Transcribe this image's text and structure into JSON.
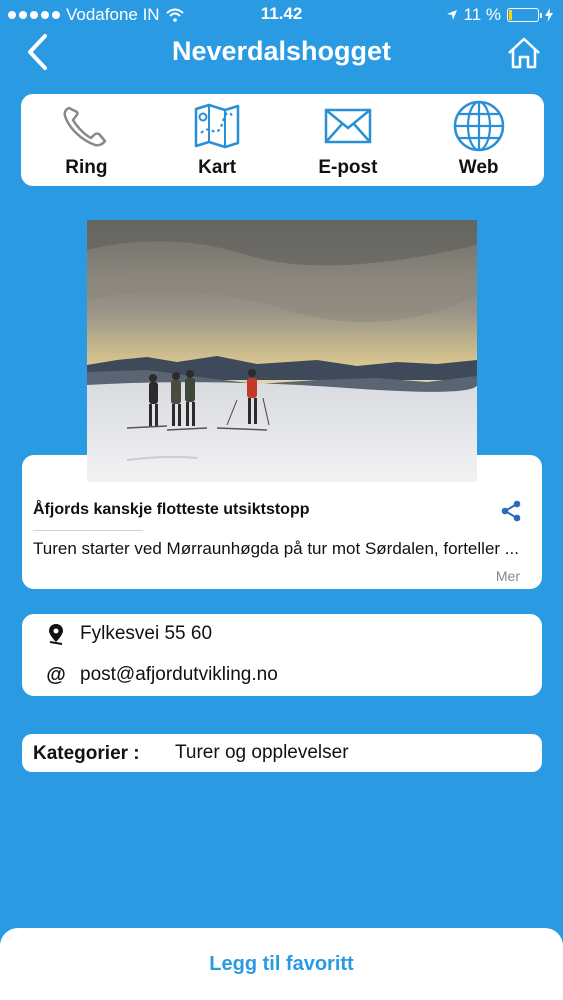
{
  "status_bar": {
    "carrier": "Vodafone IN",
    "time": "11.42",
    "battery": "11 %",
    "battery_level": 0.11
  },
  "nav": {
    "title": "Neverdalshogget",
    "back_icon": "chevron-left-icon",
    "home_icon": "home-icon"
  },
  "actions": [
    {
      "label": "Ring",
      "icon": "phone-icon"
    },
    {
      "label": "Kart",
      "icon": "map-icon"
    },
    {
      "label": "E-post",
      "icon": "mail-icon"
    },
    {
      "label": "Web",
      "icon": "globe-icon"
    }
  ],
  "info": {
    "title": "Åfjords kanskje flotteste utsiktstopp",
    "description": "Turen starter ved Mørraunhøgda på tur mot Sørdalen, forteller ...",
    "more_label": "Mer"
  },
  "contact": {
    "address": "Fylkesvei 55 60",
    "email": "post@afjordutvikling.no",
    "email_icon": "@"
  },
  "category": {
    "label": "Kategorier :",
    "value": "Turer og opplevelser"
  },
  "favorite": {
    "label": "Legg til favoritt"
  },
  "colors": {
    "background": "#2a9be3",
    "accent": "#2a9be3",
    "card": "#ffffff",
    "icon_blue": "#2a8fd6",
    "battery_yellow": "#ffd400"
  }
}
